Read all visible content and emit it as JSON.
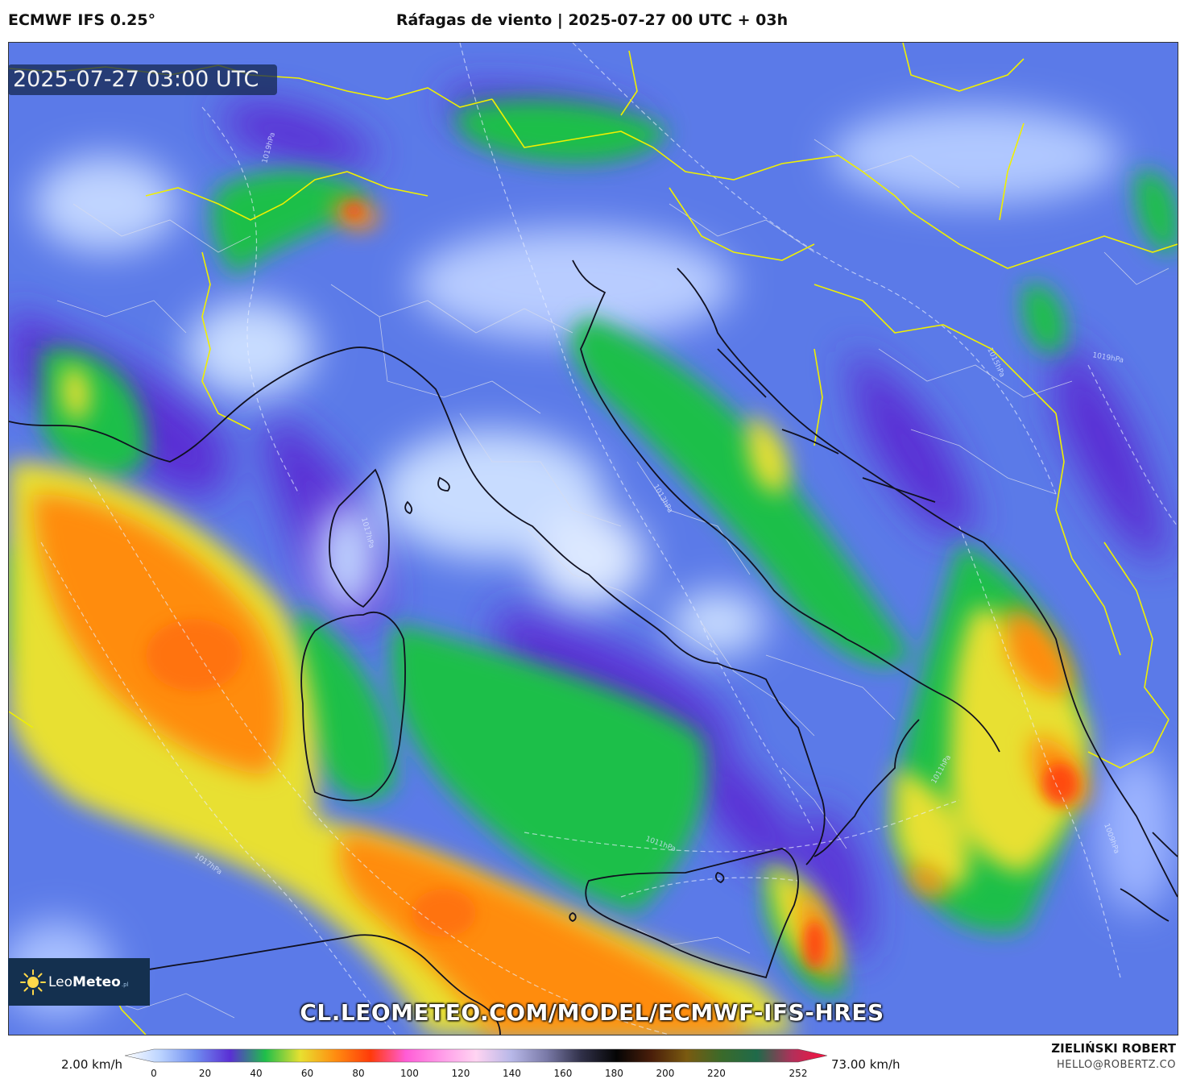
{
  "header": {
    "model": "ECMWF IFS 0.25°",
    "title": "Ráfagas de viento | 2025-07-27 00 UTC + 03h"
  },
  "map": {
    "timestamp": "2025-07-27 03:00 UTC",
    "watermark": "CL.LEOMETEO.COM/MODEL/ECMWF-IFS-HRES",
    "isobar_labels": [
      "1019hPa",
      "1017hPa",
      "1017hPa",
      "1015hPa",
      "1013hPa",
      "1011hPa",
      "1011hPa",
      "1009hPa",
      "1019hPa"
    ]
  },
  "logo": {
    "brand_light": "Leo",
    "brand_bold": "Meteo",
    "suffix": ".pl"
  },
  "legend": {
    "min_label": "2.00 km/h",
    "max_label": "73.00 km/h",
    "ticks": [
      "0",
      "20",
      "40",
      "60",
      "80",
      "100",
      "120",
      "140",
      "160",
      "180",
      "200",
      "220",
      "252"
    ],
    "colors": [
      "#ffffff",
      "#bcd4ff",
      "#6f8df0",
      "#5a2fd4",
      "#1fbf4a",
      "#e8e030",
      "#ff8c10",
      "#ff3a0a",
      "#ff5cd6",
      "#ff9ae8",
      "#ffd4f2",
      "#b8b8e8",
      "#7a7aa8",
      "#303048",
      "#050505",
      "#4a1e0a",
      "#7a5a10",
      "#3a6a2a",
      "#1f6a4a",
      "#b0305a",
      "#ff1040"
    ]
  },
  "credits": {
    "author": "ZIELIŃSKI ROBERT",
    "email": "HELLO@ROBERTZ.CO"
  }
}
